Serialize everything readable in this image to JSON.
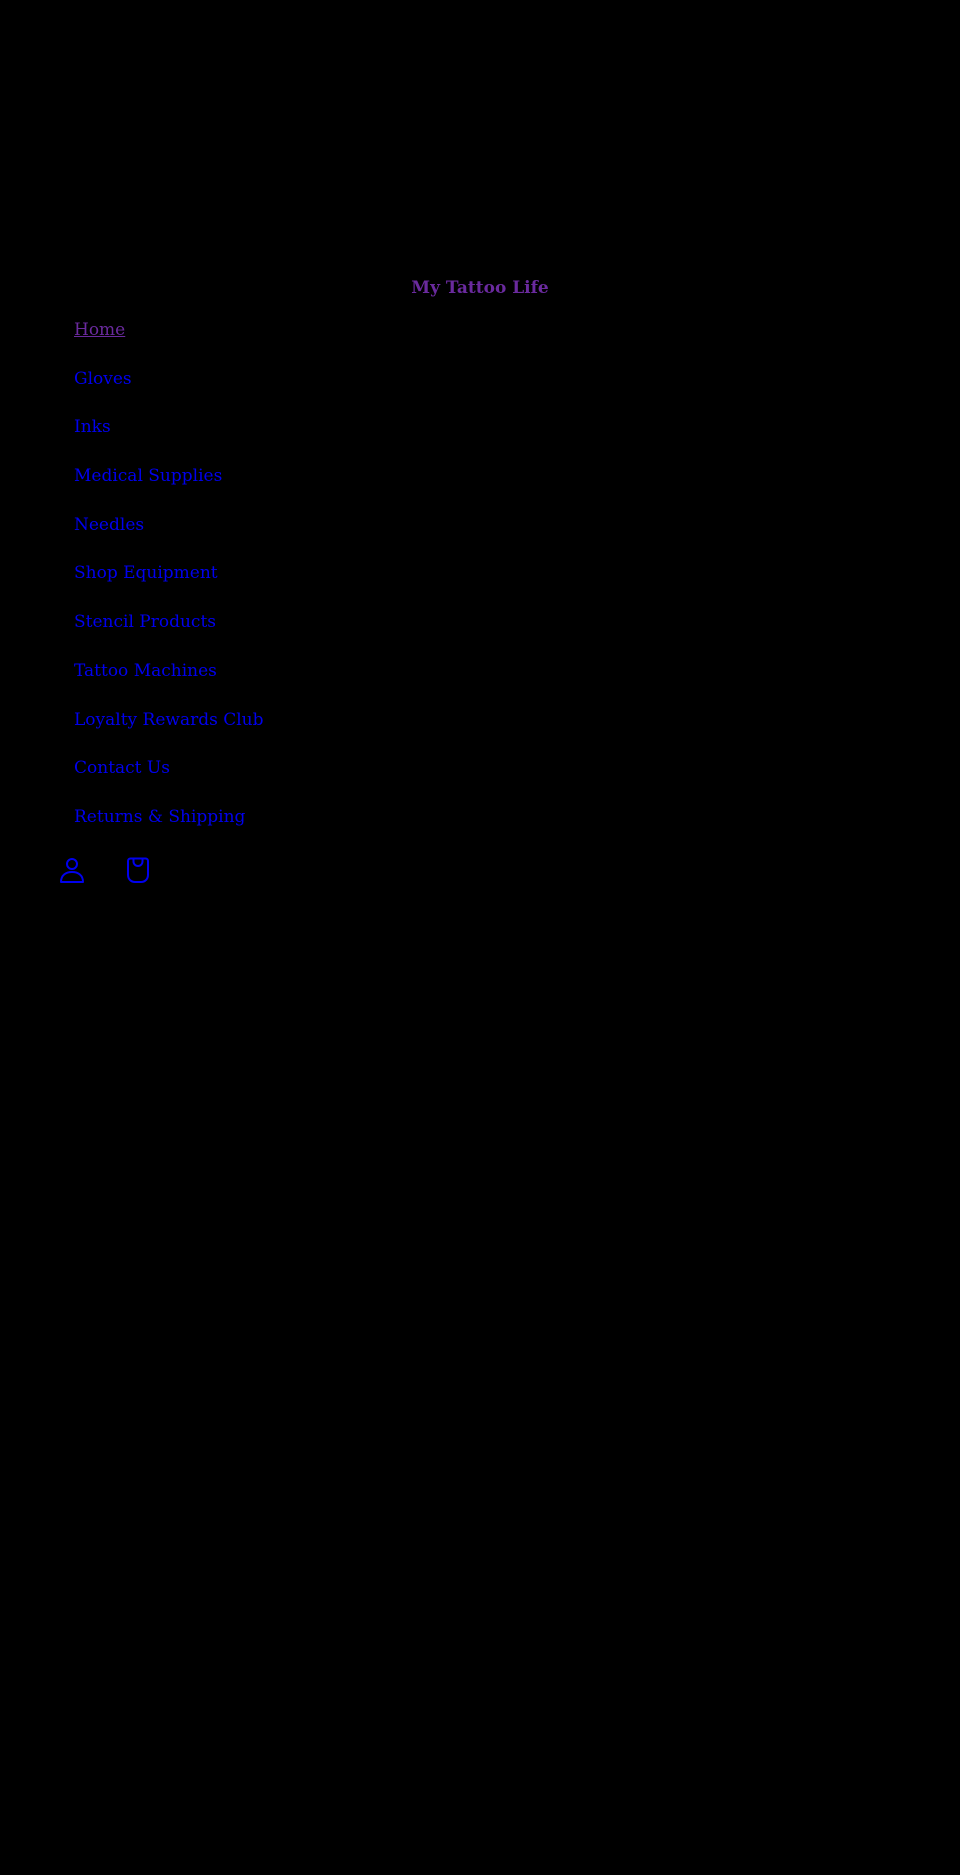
{
  "header": {
    "site_title": "My Tattoo Life"
  },
  "nav": {
    "items": [
      {
        "label": "Home"
      },
      {
        "label": "Gloves"
      },
      {
        "label": "Inks"
      },
      {
        "label": "Medical Supplies"
      },
      {
        "label": "Needles"
      },
      {
        "label": "Shop Equipment"
      },
      {
        "label": "Stencil Products"
      },
      {
        "label": "Tattoo Machines"
      },
      {
        "label": "Loyalty Rewards Club"
      },
      {
        "label": "Contact Us"
      },
      {
        "label": "Returns & Shipping"
      }
    ]
  },
  "icons": {
    "account": "user-icon",
    "cart": "shopping-bag-icon"
  },
  "colors": {
    "background": "#000000",
    "link": "#0000ee",
    "visited_link": "#6a2a9e"
  }
}
